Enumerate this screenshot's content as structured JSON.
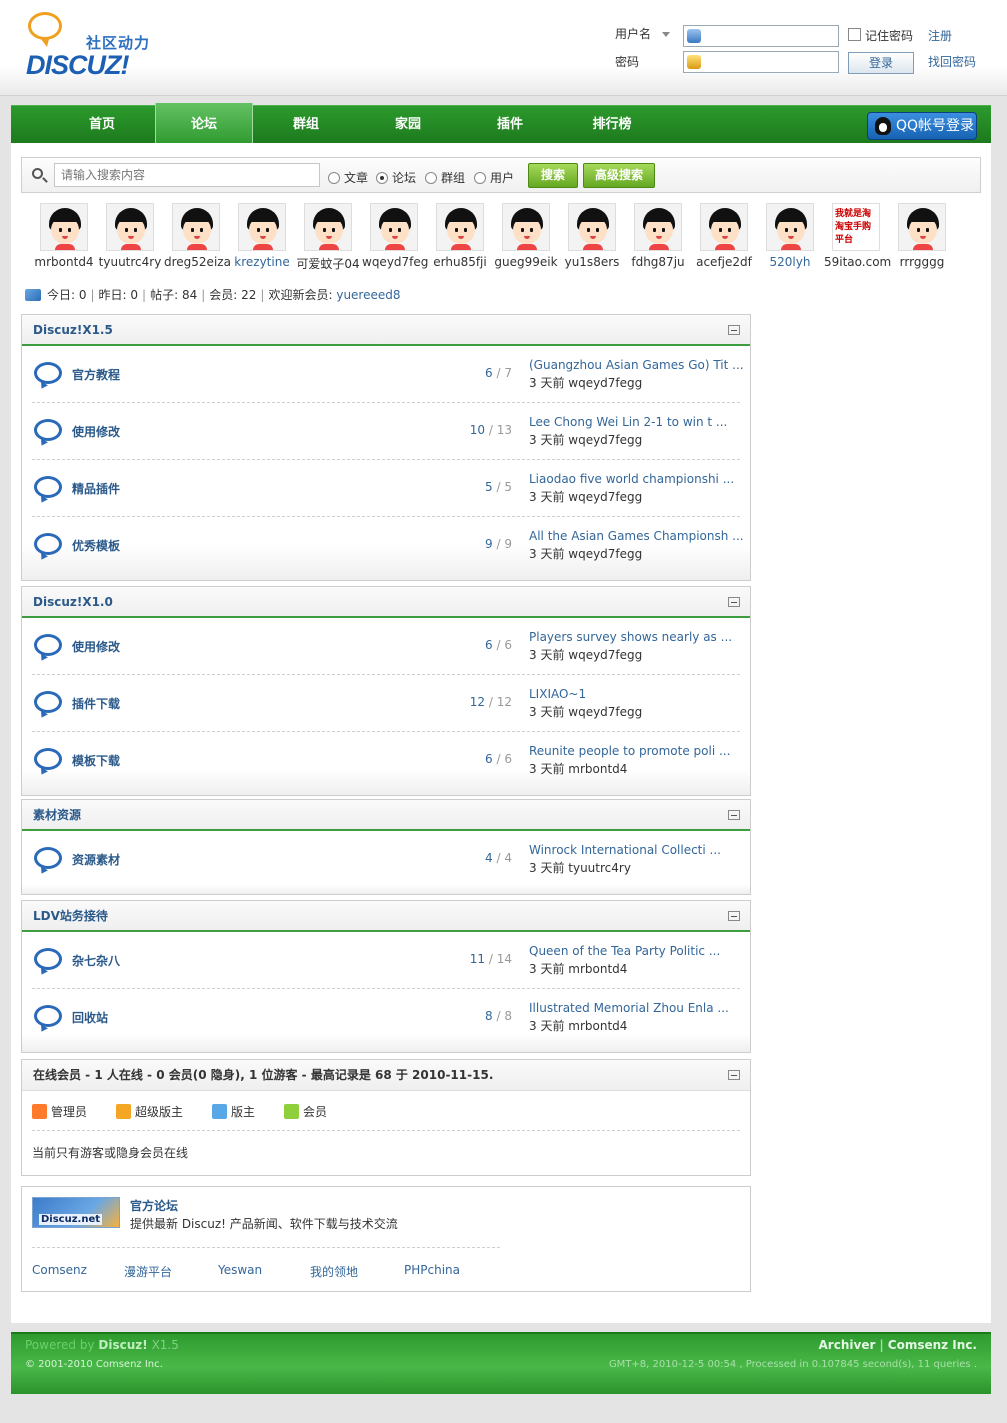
{
  "header": {
    "logo_slogan": "社区动力",
    "logo_word": "DISCUZ!",
    "username_label": "用户名",
    "password_label": "密码",
    "remember_label": "记住密码",
    "login_button": "登录",
    "register_link": "注册",
    "forgot_link": "找回密码"
  },
  "nav": {
    "items": [
      "首页",
      "论坛",
      "群组",
      "家园",
      "插件",
      "排行榜"
    ],
    "active": "论坛",
    "qq_login": "QQ帐号登录"
  },
  "search": {
    "placeholder": "请输入搜索内容",
    "options": [
      "文章",
      "论坛",
      "群组",
      "用户"
    ],
    "selected": "论坛",
    "search_button": "搜索",
    "advanced_button": "高级搜索"
  },
  "avatars": [
    "mrbontd4",
    "tyuutrc4ry",
    "dreg52eiza",
    "krezytine",
    "可爱蚊子04",
    "wqeyd7feg",
    "erhu85fji",
    "gueg99eik",
    "yu1s8ers",
    "fdhg87ju",
    "acefje2df",
    "520lyh",
    "59itao.com",
    "rrrgggg"
  ],
  "avatar_ad_text": "我就是淘 淘宝手购平台",
  "stats": {
    "today": "今日: 0",
    "yesterday": "昨日: 0",
    "posts": "帖子: 84",
    "members": "会员: 22",
    "welcome": "欢迎新会员:",
    "newest": "yuereeed8"
  },
  "categories": [
    {
      "title": "Discuz!X1.5",
      "forums": [
        {
          "name": "官方教程",
          "threads": "6",
          "posts": "7",
          "last_title": "(Guangzhou Asian Games Go) Tit ...",
          "last_meta": "3 天前 wqeyd7fegg"
        },
        {
          "name": "使用修改",
          "threads": "10",
          "posts": "13",
          "last_title": "Lee Chong Wei Lin 2-1 to win t ...",
          "last_meta": "3 天前 wqeyd7fegg"
        },
        {
          "name": "精品插件",
          "threads": "5",
          "posts": "5",
          "last_title": "Liaodao five world championshi ...",
          "last_meta": "3 天前 wqeyd7fegg"
        },
        {
          "name": "优秀模板",
          "threads": "9",
          "posts": "9",
          "last_title": "All the Asian Games Championsh ...",
          "last_meta": "3 天前 wqeyd7fegg"
        }
      ]
    },
    {
      "title": "Discuz!X1.0",
      "forums": [
        {
          "name": "使用修改",
          "threads": "6",
          "posts": "6",
          "last_title": "Players survey shows nearly as ...",
          "last_meta": "3 天前 wqeyd7fegg"
        },
        {
          "name": "插件下载",
          "threads": "12",
          "posts": "12",
          "last_title": "LIXIAO~1",
          "last_meta": "3 天前 wqeyd7fegg"
        },
        {
          "name": "模板下载",
          "threads": "6",
          "posts": "6",
          "last_title": "Reunite people to promote poli ...",
          "last_meta": "3 天前 mrbontd4"
        }
      ]
    },
    {
      "title": "素材资源",
      "forums": [
        {
          "name": "资源素材",
          "threads": "4",
          "posts": "4",
          "last_title": "Winrock International Collecti ...",
          "last_meta": "3 天前 tyuutrc4ry"
        }
      ]
    },
    {
      "title": "LDV站务接待",
      "forums": [
        {
          "name": "杂七杂八",
          "threads": "11",
          "posts": "14",
          "last_title": "Queen of the Tea Party Politic ...",
          "last_meta": "3 天前 mrbontd4"
        },
        {
          "name": "回收站",
          "threads": "8",
          "posts": "8",
          "last_title": "Illustrated Memorial Zhou Enla ...",
          "last_meta": "3 天前 mrbontd4"
        }
      ]
    }
  ],
  "online": {
    "title": "在线会员 - 1 人在线 - 0 会员(0 隐身), 1 位游客 - 最高记录是 68 于 2010-11-15.",
    "legend": [
      "管理员",
      "超级版主",
      "版主",
      "会员"
    ],
    "legend_colors": [
      "#ff7a2b",
      "#f5a623",
      "#58a8e8",
      "#8fcf3a"
    ],
    "note": "当前只有游客或隐身会员在线"
  },
  "links": {
    "logo_text": "Discuz.net",
    "forum_name": "官方论坛",
    "forum_desc": "提供最新 Discuz! 产品新闻、软件下载与技术交流",
    "friends": [
      "Comsenz",
      "漫游平台",
      "Yeswan",
      "我的领地",
      "PHPchina"
    ]
  },
  "footer": {
    "powered_by": "Powered by",
    "brand": "Discuz!",
    "version": "X1.5",
    "copyright": "© 2001-2010 Comsenz Inc.",
    "archiver": "Archiver",
    "company": "Comsenz Inc.",
    "processed": "GMT+8, 2010-12-5 00:54 , Processed in 0.107845 second(s), 11 queries ."
  }
}
